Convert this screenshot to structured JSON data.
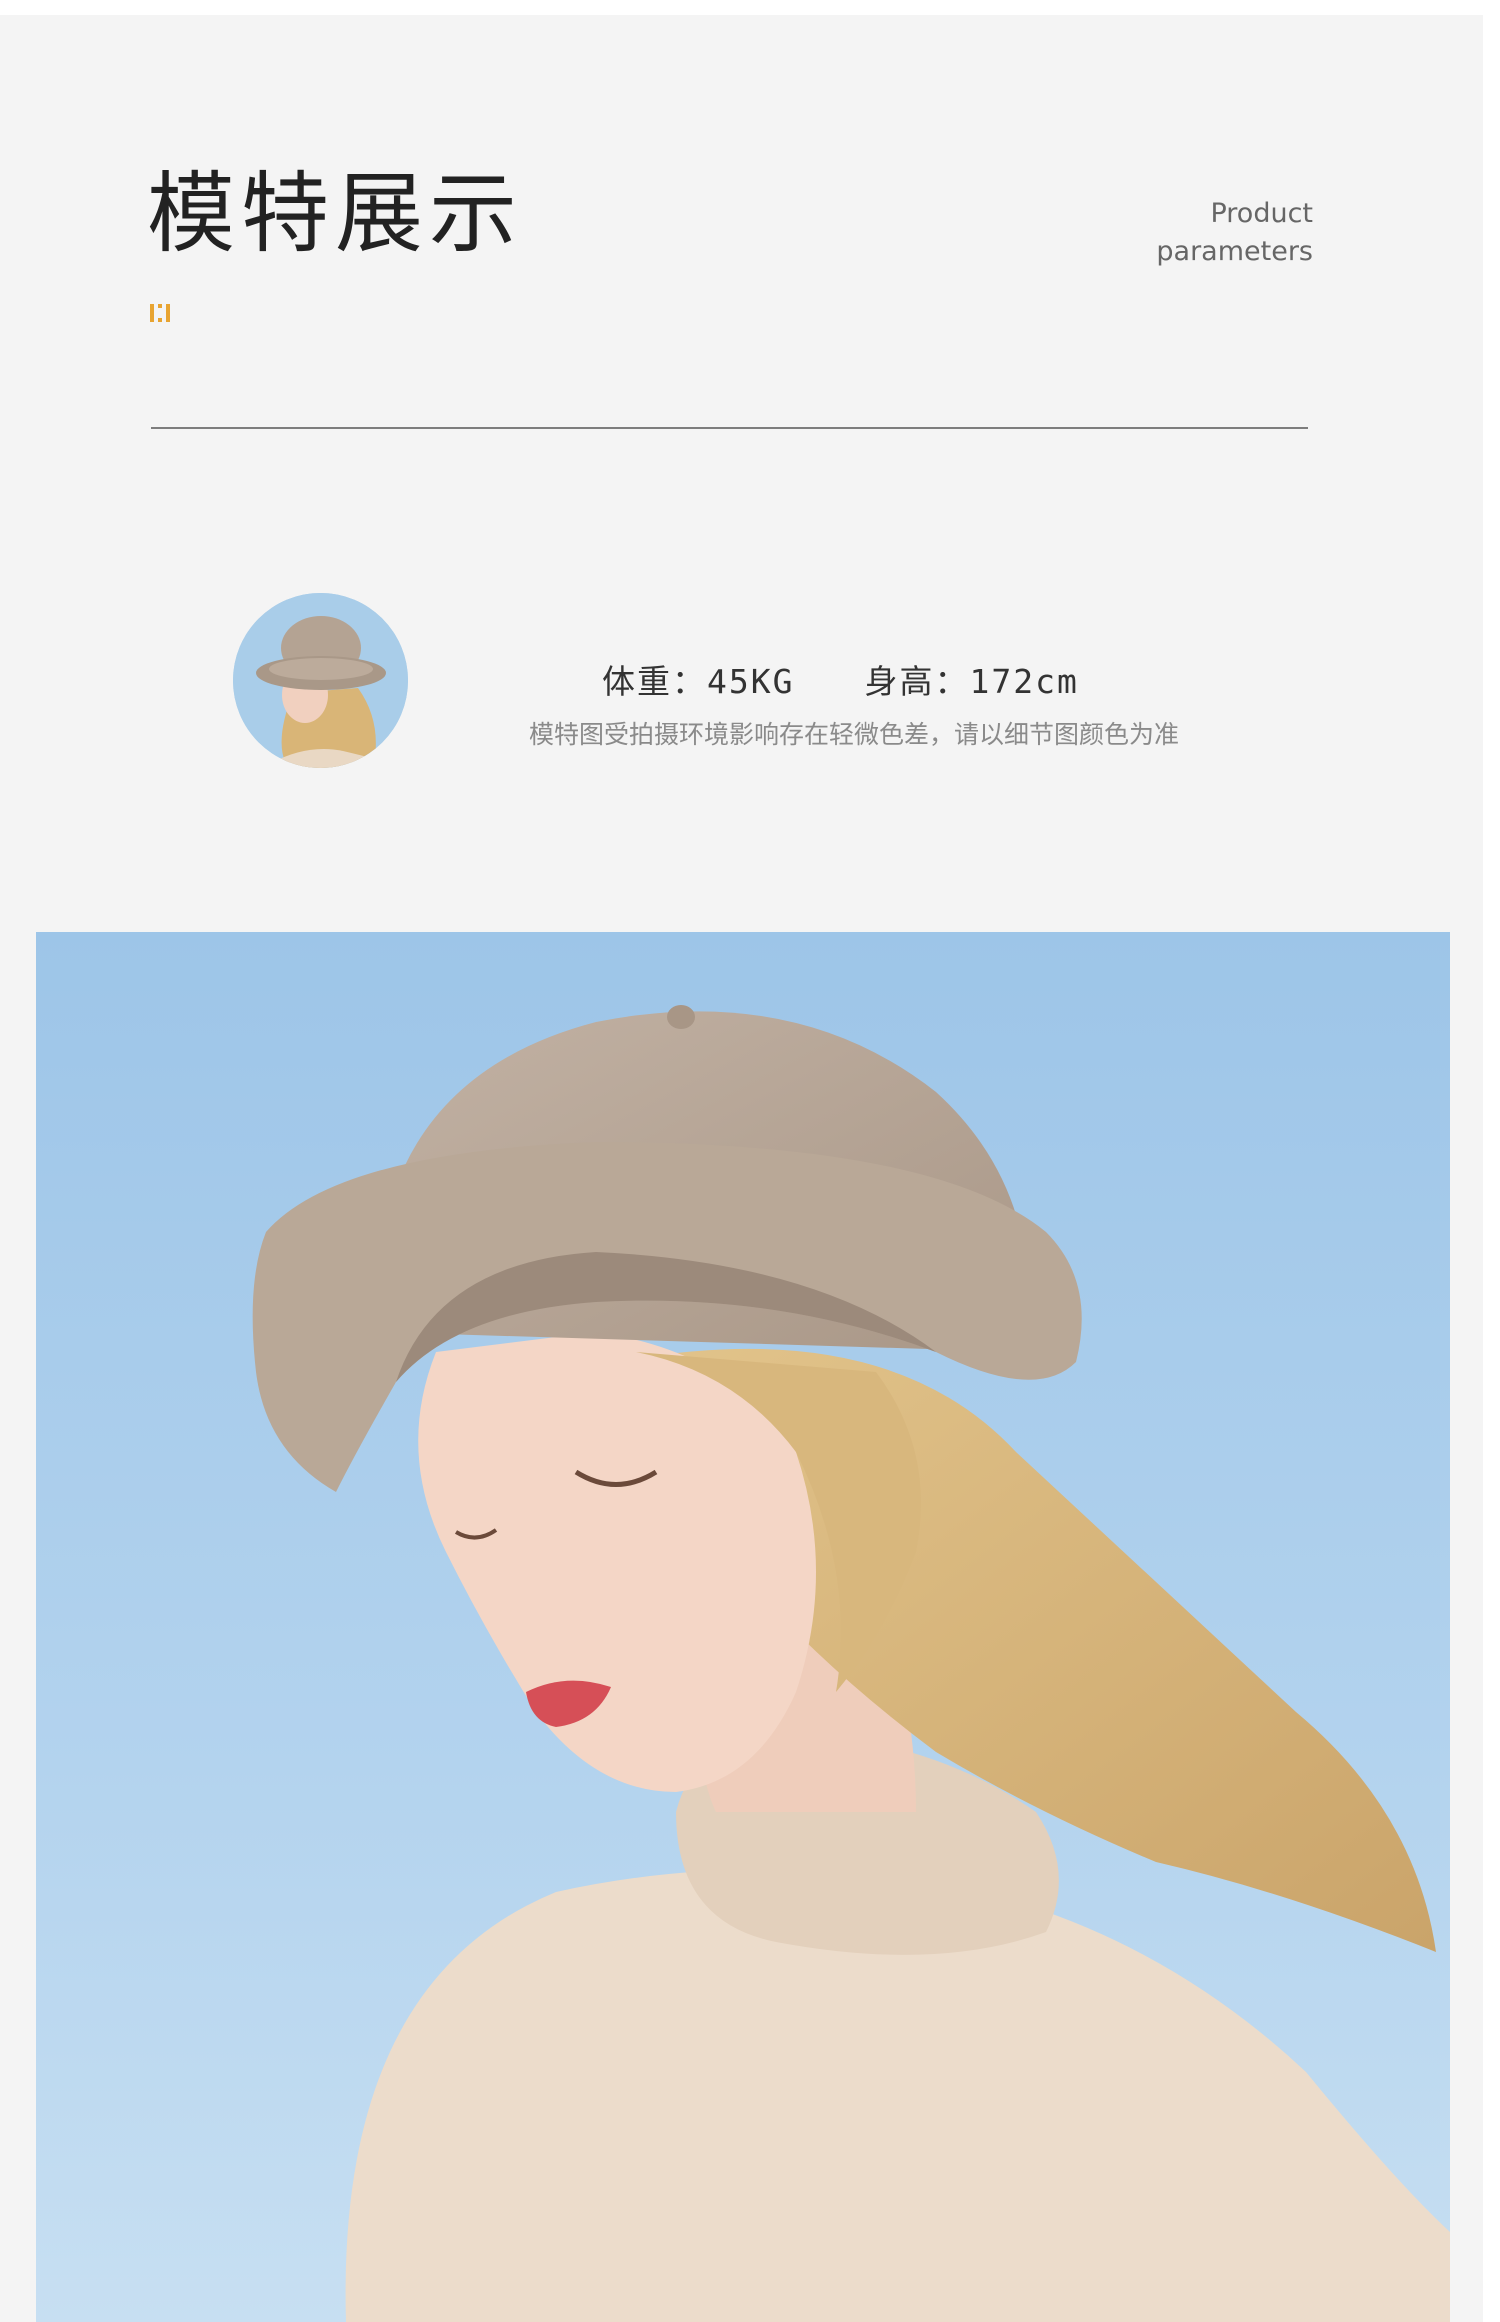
{
  "header": {
    "title": "模特展示",
    "subtitle_line1": "Product",
    "subtitle_line2": "parameters",
    "accent_color": "#e8a431"
  },
  "model_info": {
    "weight": "体重：45KG",
    "height": "身高：172cm",
    "note": "模特图受拍摄环境影响存在轻微色差，请以细节图颜色为准"
  },
  "images": {
    "avatar": "model-portrait-thumbnail",
    "hero": "model-wearing-wool-bucket-hat"
  }
}
